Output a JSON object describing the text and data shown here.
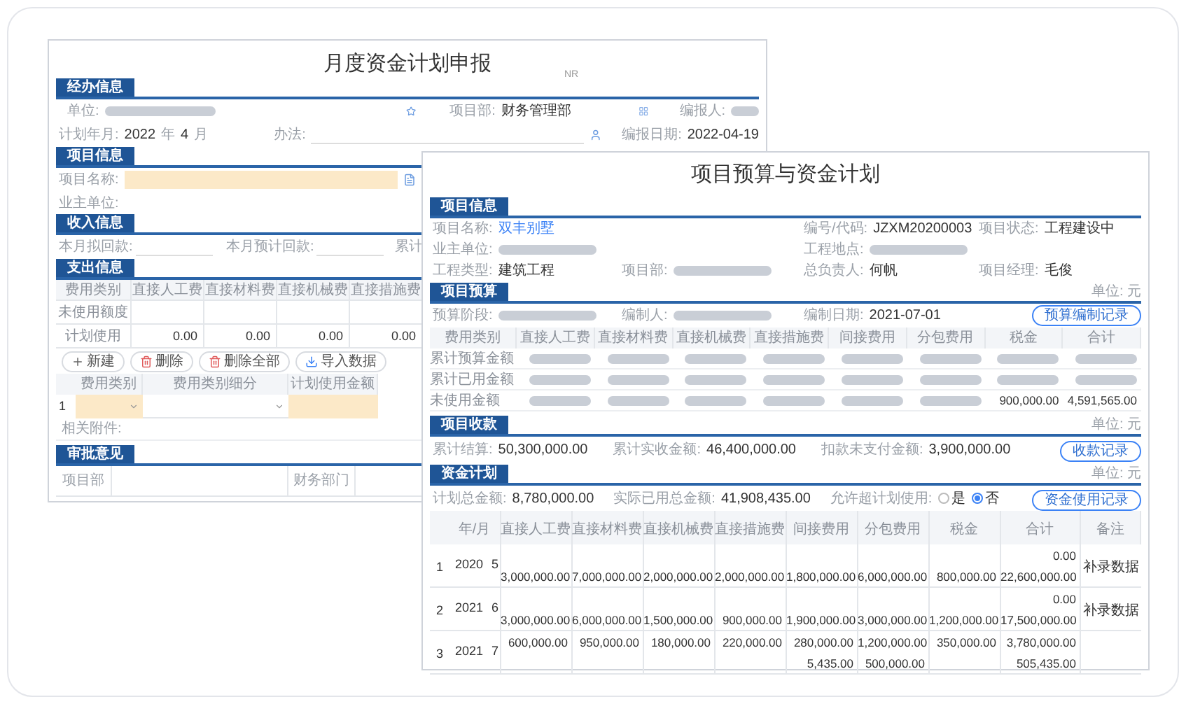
{
  "left_form": {
    "title": "月度资金计划申报",
    "corner_note": "NR",
    "handler": {
      "heading": "经办信息",
      "unit_label": "单位:",
      "dept_label": "项目部:",
      "dept_value": "财务管理部",
      "reporter_label": "编报人:",
      "period_label": "计划年月:",
      "year": "2022",
      "year_unit": "年",
      "month": "4",
      "month_unit": "月",
      "method_label": "办法:",
      "date_label": "编报日期:",
      "date": "2022-04-19"
    },
    "project": {
      "heading": "项目信息",
      "name_label": "项目名称:",
      "owner_label": "业主单位:"
    },
    "income": {
      "heading": "收入信息",
      "labels": [
        "本月拟回款:",
        "本月预计回款:",
        "累计"
      ]
    },
    "expense": {
      "heading": "支出信息",
      "label_column": "费用类别",
      "columns": [
        "直接人工费",
        "直接材料费",
        "直接机械费",
        "直接措施费"
      ],
      "rows": [
        {
          "label": "未使用额度"
        },
        {
          "label": "计划使用",
          "values": [
            "0.00",
            "0.00",
            "0.00",
            "0.00"
          ]
        }
      ],
      "buttons": [
        {
          "kind": "add",
          "label": "新建"
        },
        {
          "kind": "delete",
          "label": "删除"
        },
        {
          "kind": "delete_all",
          "label": "删除全部"
        },
        {
          "kind": "import",
          "label": "导入数据"
        }
      ],
      "detail_columns": [
        "费用类别",
        "费用类别细分",
        "计划使用金额"
      ],
      "detail_rows": [
        {
          "index": "1"
        }
      ],
      "attachment_label": "相关附件:"
    },
    "approval": {
      "heading": "审批意见",
      "labels": [
        "项目部",
        "财务部门"
      ]
    }
  },
  "right_form": {
    "title": "项目预算与资金计划",
    "project": {
      "heading": "项目信息",
      "rows": [
        [
          {
            "label": "项目名称:",
            "kind": "link",
            "value": "双丰别墅"
          },
          {
            "kind": "blank"
          },
          {
            "label": "编号/代码:",
            "kind": "text",
            "value": "JZXM20200003"
          },
          {
            "label": "项目状态:",
            "kind": "text",
            "value": "工程建设中"
          }
        ],
        [
          {
            "label": "业主单位:",
            "kind": "redacted"
          },
          {
            "kind": "blank"
          },
          {
            "label": "工程地点:",
            "kind": "redacted"
          },
          {
            "kind": "blank"
          }
        ],
        [
          {
            "label": "工程类型:",
            "kind": "text",
            "value": "建筑工程"
          },
          {
            "label": "项目部:",
            "kind": "redacted"
          },
          {
            "label": "总负责人:",
            "kind": "text",
            "value": "何帆"
          },
          {
            "label": "项目经理:",
            "kind": "text",
            "value": "毛俊"
          }
        ]
      ]
    },
    "budget": {
      "heading": "项目预算",
      "unit": "单位: 元",
      "fields": [
        {
          "label": "预算阶段:",
          "kind": "redacted"
        },
        {
          "label": "编制人:",
          "kind": "redacted"
        },
        {
          "label": "编制日期:",
          "kind": "text",
          "value": "2021-07-01"
        }
      ],
      "button": "预算编制记录",
      "label_column": "费用类别",
      "columns": [
        "直接人工费",
        "直接材料费",
        "直接机械费",
        "直接措施费",
        "间接费用",
        "分包费用",
        "税金",
        "合计"
      ],
      "rows": [
        {
          "label": "累计预算金额",
          "cells": [
            {
              "kind": "redacted"
            },
            {
              "kind": "redacted"
            },
            {
              "kind": "redacted"
            },
            {
              "kind": "redacted"
            },
            {
              "kind": "redacted"
            },
            {
              "kind": "redacted"
            },
            {
              "kind": "redacted"
            },
            {
              "kind": "redacted"
            }
          ]
        },
        {
          "label": "累计已用金额",
          "cells": [
            {
              "kind": "redacted"
            },
            {
              "kind": "redacted"
            },
            {
              "kind": "redacted"
            },
            {
              "kind": "redacted"
            },
            {
              "kind": "redacted"
            },
            {
              "kind": "redacted"
            },
            {
              "kind": "redacted"
            },
            {
              "kind": "redacted"
            }
          ]
        },
        {
          "label": "未使用金额",
          "cells": [
            {
              "kind": "redacted"
            },
            {
              "kind": "redacted"
            },
            {
              "kind": "redacted"
            },
            {
              "kind": "redacted"
            },
            {
              "kind": "redacted"
            },
            {
              "kind": "redacted"
            },
            {
              "kind": "text",
              "value": "900,000.00"
            },
            {
              "kind": "text",
              "value": "4,591,565.00"
            }
          ]
        }
      ]
    },
    "receipts": {
      "heading": "项目收款",
      "unit": "单位: 元",
      "fields": [
        {
          "label": "累计结算:",
          "kind": "text",
          "value": "50,300,000.00"
        },
        {
          "label": "累计实收金额:",
          "kind": "text",
          "value": "46,400,000.00"
        },
        {
          "label": "扣款未支付金额:",
          "kind": "text",
          "value": "3,900,000.00"
        }
      ],
      "button": "收款记录"
    },
    "fund_plan": {
      "heading": "资金计划",
      "unit": "单位: 元",
      "fields": [
        {
          "label": "计划总金额:",
          "kind": "text",
          "value": "8,780,000.00"
        },
        {
          "label": "实际已用总金额:",
          "kind": "text",
          "value": "41,908,435.00"
        }
      ],
      "overrun_label": "允许超计划使用:",
      "overrun_options": [
        {
          "label": "是",
          "selected": false
        },
        {
          "label": "否",
          "selected": true
        }
      ],
      "button": "资金使用记录",
      "period_column": "年/月",
      "amount_columns": [
        "直接人工费",
        "直接材料费",
        "直接机械费",
        "直接措施费",
        "间接费用",
        "分包费用",
        "税金",
        "合计"
      ],
      "note_column": "备注",
      "rows": [
        {
          "index": "1",
          "year": "2020",
          "month": "5",
          "lines": [
            [
              {
                "kind": "blank"
              },
              {
                "kind": "blank"
              },
              {
                "kind": "blank"
              },
              {
                "kind": "blank"
              },
              {
                "kind": "blank"
              },
              {
                "kind": "blank"
              },
              {
                "kind": "blank"
              },
              {
                "kind": "amount",
                "value": "0.00"
              }
            ],
            [
              {
                "kind": "amount",
                "value": "3,000,000.00"
              },
              {
                "kind": "amount",
                "value": "7,000,000.00"
              },
              {
                "kind": "amount",
                "value": "2,000,000.00"
              },
              {
                "kind": "amount",
                "value": "2,000,000.00"
              },
              {
                "kind": "amount",
                "value": "1,800,000.00"
              },
              {
                "kind": "amount",
                "value": "6,000,000.00"
              },
              {
                "kind": "amount",
                "value": "800,000.00"
              },
              {
                "kind": "amount",
                "value": "22,600,000.00"
              }
            ]
          ],
          "note": "补录数据"
        },
        {
          "index": "2",
          "year": "2021",
          "month": "6",
          "lines": [
            [
              {
                "kind": "blank"
              },
              {
                "kind": "blank"
              },
              {
                "kind": "blank"
              },
              {
                "kind": "blank"
              },
              {
                "kind": "blank"
              },
              {
                "kind": "blank"
              },
              {
                "kind": "blank"
              },
              {
                "kind": "amount",
                "value": "0.00"
              }
            ],
            [
              {
                "kind": "amount",
                "value": "3,000,000.00"
              },
              {
                "kind": "amount",
                "value": "6,000,000.00"
              },
              {
                "kind": "amount",
                "value": "1,500,000.00"
              },
              {
                "kind": "amount",
                "value": "900,000.00"
              },
              {
                "kind": "amount",
                "value": "1,900,000.00"
              },
              {
                "kind": "amount",
                "value": "3,000,000.00"
              },
              {
                "kind": "amount",
                "value": "1,200,000.00"
              },
              {
                "kind": "amount",
                "value": "17,500,000.00"
              }
            ]
          ],
          "note": "补录数据"
        },
        {
          "index": "3",
          "year": "2021",
          "month": "7",
          "lines": [
            [
              {
                "kind": "amount",
                "value": "600,000.00"
              },
              {
                "kind": "amount",
                "value": "950,000.00"
              },
              {
                "kind": "amount",
                "value": "180,000.00"
              },
              {
                "kind": "amount",
                "value": "220,000.00"
              },
              {
                "kind": "amount",
                "value": "280,000.00"
              },
              {
                "kind": "amount",
                "value": "1,200,000.00"
              },
              {
                "kind": "amount",
                "value": "350,000.00"
              },
              {
                "kind": "amount",
                "value": "3,780,000.00"
              }
            ],
            [
              {
                "kind": "blank"
              },
              {
                "kind": "blank"
              },
              {
                "kind": "blank"
              },
              {
                "kind": "blank"
              },
              {
                "kind": "amount",
                "value": "5,435.00"
              },
              {
                "kind": "amount",
                "value": "500,000.00"
              },
              {
                "kind": "blank"
              },
              {
                "kind": "amount",
                "value": "505,435.00"
              }
            ]
          ]
        }
      ]
    }
  }
}
